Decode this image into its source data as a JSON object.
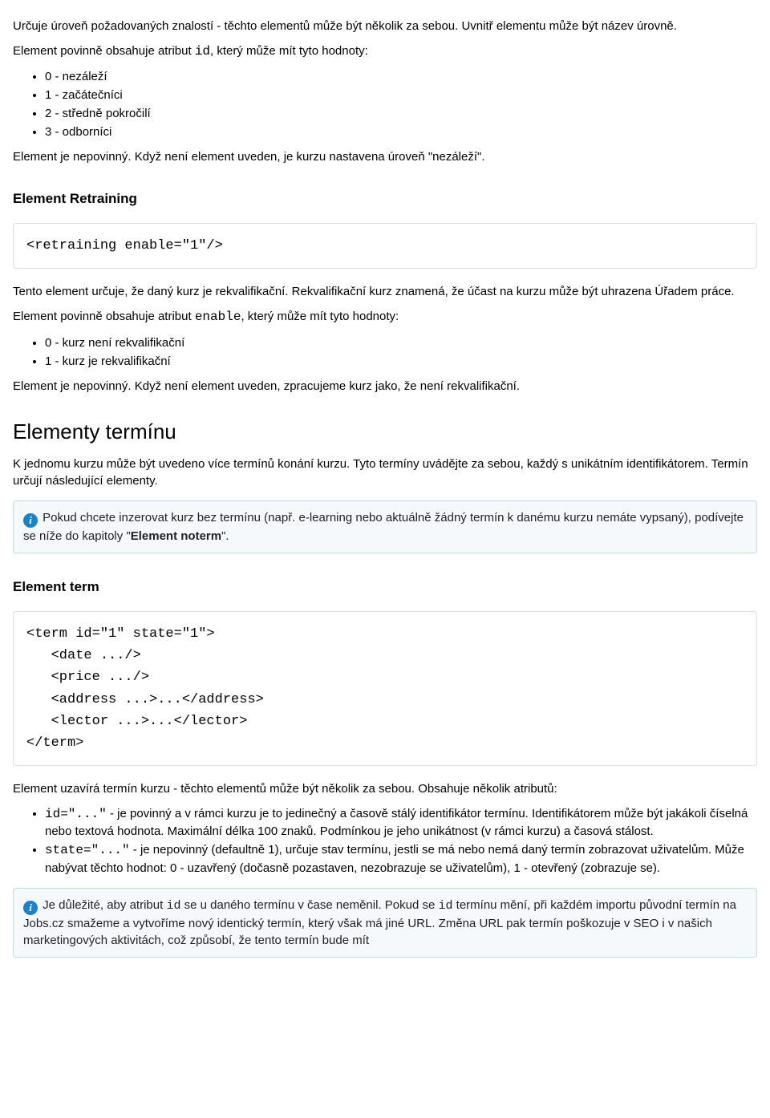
{
  "intro": {
    "p1": "Určuje úroveň požadovaných znalostí - těchto elementů může být několik za sebou. Uvnitř elementu může být název úrovně.",
    "p2_a": "Element povinně obsahuje atribut ",
    "p2_code": "id",
    "p2_b": ", který může mít tyto hodnoty:",
    "list": [
      "0 - nezáleží",
      "1 - začátečníci",
      "2 - středně pokročilí",
      "3 - odborníci"
    ],
    "p3": "Element je nepovinný. Když není element uveden, je kurzu nastavena úroveň \"nezáleží\"."
  },
  "retraining": {
    "heading": "Element Retraining",
    "code": "<retraining enable=\"1\"/>",
    "p1": "Tento element určuje, že daný kurz je rekvalifikační. Rekvalifikační kurz znamená, že účast na kurzu může být uhrazena Úřadem práce.",
    "p2_a": "Element povinně obsahuje atribut ",
    "p2_code": "enable",
    "p2_b": ", který může mít tyto hodnoty:",
    "list": [
      "0 - kurz není rekvalifikační",
      "1 - kurz je rekvalifikační"
    ],
    "p3": "Element je nepovinný. Když není element uveden, zpracujeme kurz jako, že není rekvalifikační."
  },
  "terminy": {
    "heading": "Elementy termínu",
    "p1": "K jednomu kurzu může být uvedeno více termínů konání kurzu. Tyto termíny uvádějte za sebou, každý s unikátním identifikátorem. Termín určují následující elementy.",
    "info_a": " Pokud chcete inzerovat kurz bez termínu (např. e-learning nebo aktuálně žádný termín k danému kurzu nemáte vypsaný), podívejte se níže do kapitoly \"",
    "info_strong": "Element noterm",
    "info_b": "\"."
  },
  "term": {
    "heading": "Element term",
    "code": "<term id=\"1\" state=\"1\">\n   <date .../>\n   <price .../>\n   <address ...>...</address>\n   <lector ...>...</lector>\n</term>",
    "p1": "Element uzavírá termín kurzu - těchto elementů může být několik za sebou. Obsahuje několik atributů:",
    "li1_code": "id=\"...\"",
    "li1_text": " - je povinný a v rámci kurzu je to jedinečný a časově stálý identifikátor termínu. Identifikátorem může být jakákoli číselná nebo textová hodnota. Maximální délka 100 znaků. Podmínkou je jeho unikátnost (v rámci kurzu) a časová stálost.",
    "li2_code": "state=\"...\"",
    "li2_text": " - je nepovinný (defaultně 1), určuje stav termínu, jestli se má nebo nemá daný termín zobrazovat uživatelům. Může nabývat těchto hodnot: 0 - uzavřený (dočasně pozastaven, nezobrazuje se uživatelům), 1 - otevřený (zobrazuje se).",
    "info_a": " Je důležité, aby atribut ",
    "info_code1": "id",
    "info_b": " se u daného termínu v čase neměnil. Pokud se ",
    "info_code2": "id",
    "info_c": " termínu mění, při každém importu původní termín na Jobs.cz smažeme a vytvoříme nový identický termín, který však má jiné URL. Změna URL pak termín poškozuje v SEO i v našich marketingových aktivitách, což způsobí, že tento termín bude mít"
  }
}
